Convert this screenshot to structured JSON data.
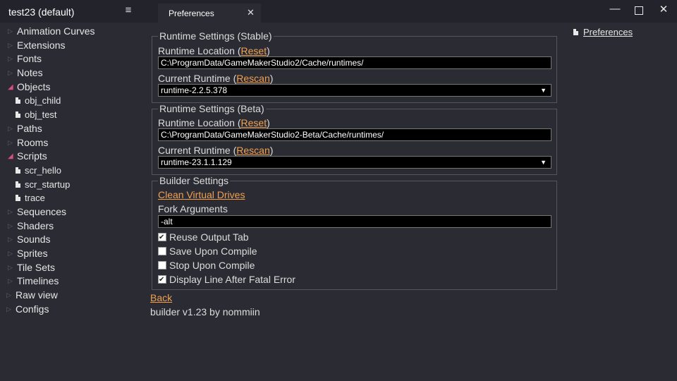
{
  "window": {
    "title": "test23 (default)",
    "menu_icon": "hamburger-icon",
    "tab_label": "Preferences",
    "tab_close": "✕",
    "minimize": "—",
    "close": "✕"
  },
  "sidebar": {
    "items": [
      {
        "label": "Animation Curves"
      },
      {
        "label": "Extensions"
      },
      {
        "label": "Fonts"
      },
      {
        "label": "Notes"
      },
      {
        "label": "Objects"
      },
      {
        "label": "obj_child"
      },
      {
        "label": "obj_test"
      },
      {
        "label": "Paths"
      },
      {
        "label": "Rooms"
      },
      {
        "label": "Scripts"
      },
      {
        "label": "scr_hello"
      },
      {
        "label": "scr_startup"
      },
      {
        "label": "trace"
      },
      {
        "label": "Sequences"
      },
      {
        "label": "Shaders"
      },
      {
        "label": "Sounds"
      },
      {
        "label": "Sprites"
      },
      {
        "label": "Tile Sets"
      },
      {
        "label": "Timelines"
      },
      {
        "label": "Raw view"
      },
      {
        "label": "Configs"
      }
    ]
  },
  "stable": {
    "legend": "Runtime Settings (Stable)",
    "location_prefix": "Runtime Location (",
    "location_link": "Reset",
    "location_suffix": ")",
    "location_value": "C:\\ProgramData/GameMakerStudio2/Cache/runtimes/",
    "current_prefix": "Current Runtime (",
    "current_link": "Rescan",
    "current_suffix": ")",
    "current_value": "runtime-2.2.5.378"
  },
  "beta": {
    "legend": "Runtime Settings (Beta)",
    "location_prefix": "Runtime Location (",
    "location_link": "Reset",
    "location_suffix": ")",
    "location_value": "C:\\ProgramData/GameMakerStudio2-Beta/Cache/runtimes/",
    "current_prefix": "Current Runtime (",
    "current_link": "Rescan",
    "current_suffix": ")",
    "current_value": "runtime-23.1.1.129"
  },
  "builder": {
    "legend": "Builder Settings",
    "clean_link": "Clean Virtual Drives",
    "fork_label": "Fork Arguments",
    "fork_value": "-alt",
    "checks": [
      {
        "label": "Reuse Output Tab",
        "checked": true
      },
      {
        "label": "Save Upon Compile",
        "checked": false
      },
      {
        "label": "Stop Upon Compile",
        "checked": false
      },
      {
        "label": "Display Line After Fatal Error",
        "checked": true
      }
    ]
  },
  "footer": {
    "back_link": "Back",
    "version": "builder v1.23 by nommiin"
  },
  "right_panel": {
    "preferences_link": "Preferences"
  },
  "colors": {
    "background": "#2b2b33",
    "titlebar": "#23232b",
    "link": "#f0a050",
    "open_arrow": "#d94f82"
  }
}
